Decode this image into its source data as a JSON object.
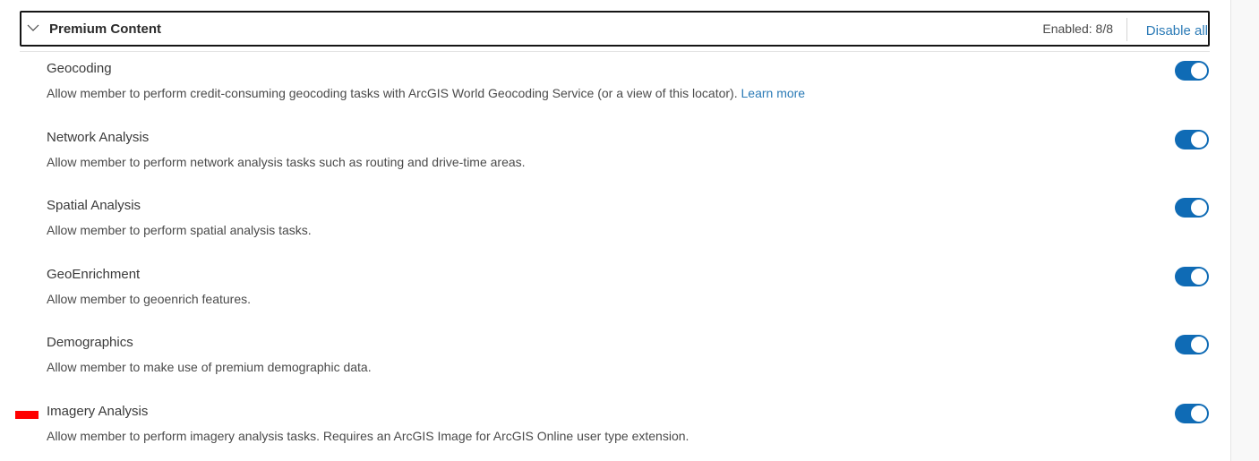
{
  "section": {
    "title": "Premium Content",
    "enabled_count": "Enabled: 8/8",
    "disable_all_label": "Disable all",
    "expanded": true
  },
  "privileges": [
    {
      "title": "Geocoding",
      "description": "Allow member to perform credit-consuming geocoding tasks with ArcGIS World Geocoding Service (or a view of this locator).",
      "link": "Learn more",
      "enabled": true
    },
    {
      "title": "Network Analysis",
      "description": "Allow member to perform network analysis tasks such as routing and drive-time areas.",
      "enabled": true
    },
    {
      "title": "Spatial Analysis",
      "description": "Allow member to perform spatial analysis tasks.",
      "enabled": true
    },
    {
      "title": "GeoEnrichment",
      "description": "Allow member to geoenrich features.",
      "enabled": true
    },
    {
      "title": "Demographics",
      "description": "Allow member to make use of premium demographic data.",
      "enabled": true
    },
    {
      "title": "Imagery Analysis",
      "description": "Allow member to perform imagery analysis tasks. Requires an ArcGIS Image for ArcGIS Online user type extension.",
      "enabled": true
    }
  ],
  "colors": {
    "accent": "#0f6bb5",
    "link": "#2a7ab6",
    "marker": "#ff0000"
  }
}
